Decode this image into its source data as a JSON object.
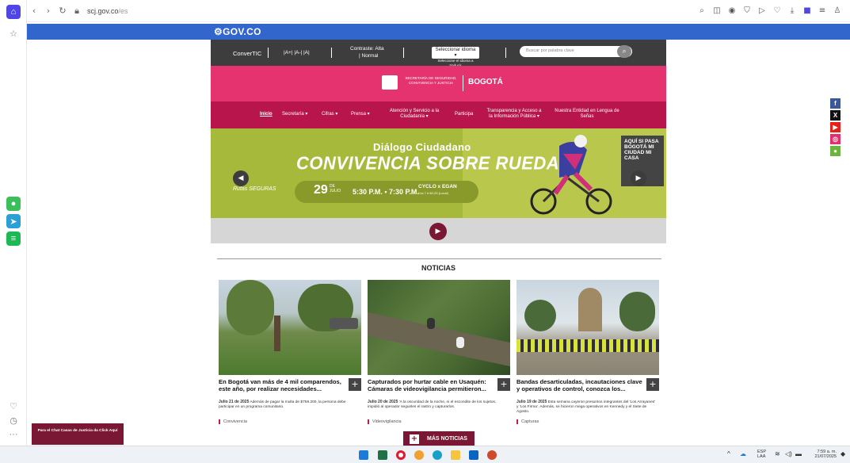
{
  "browser": {
    "url_host": "scj.gov.co",
    "url_path": "/es"
  },
  "gov": {
    "logo": "GOV.CO"
  },
  "topbar": {
    "convertic": "ConverTIC",
    "font_sizes": "|A+| |A-| |A|",
    "contrast_line1": "Contraste: Alta",
    "contrast_line2": "| Normal",
    "lang_select": "Seleccionar idioma",
    "lang_hint": "Seleccione el idioma a traducir",
    "search_placeholder": "Buscar por palabra clave"
  },
  "header": {
    "secretaria": "SECRETARÍA DE SEGURIDAD, CONVIVENCIA Y JUSTICIA",
    "bogota": "BOGOTÁ"
  },
  "nav": {
    "items": [
      {
        "label": "Inicio"
      },
      {
        "label": "Secretaría"
      },
      {
        "label": "Cifras"
      },
      {
        "label": "Prensa"
      },
      {
        "label": "Atención y Servicio a la Ciudadanía"
      },
      {
        "label": "Participa"
      },
      {
        "label": "Transparencia y Acceso a la Información Pública"
      },
      {
        "label": "Nuestra Entidad en Lengua de Señas"
      }
    ]
  },
  "banner": {
    "title": "Diálogo Ciudadano",
    "headline": "CONVIVENCIA SOBRE RUEDAS",
    "day": "29",
    "month_top": "DE",
    "month": "JULIO",
    "time": "5:30 P.M. • 7:30 P.M.",
    "place": "CYCLO x EGAN",
    "address": "Cra 7 # 80-29 (Local)",
    "rutas": "Rutas SEGURAS",
    "aqui": "AQUÍ SI PASA BOGOTÁ MI CIUDAD MI CASA"
  },
  "news": {
    "heading": "NOTICIAS",
    "more": "MÁS NOTICIAS",
    "items": [
      {
        "title": "En Bogotá van más de 4 mil comparendos, este año, por realizar necesidades...",
        "date": "Julio 21 de 2025",
        "snippet": "Además de pagar la multa de $759.200, la persona debe participar en un programa comunitario.",
        "category": "Convivencia"
      },
      {
        "title": "Capturados por hurtar cable en Usaquén: Cámaras de videovigilancia permitieron...",
        "date": "Julio 20 de 2025",
        "snippet": "'A la oscuridad de la noche, ni el escondite de los sujetos, impidió al operador seguirles el rastro y capturarlos.",
        "category": "Videovigilancia"
      },
      {
        "title": "Bandas desarticuladas, incautaciones clave y operativos de control, conozca los...",
        "date": "Julio 19 de 2025",
        "snippet": "Esta semana cayeron presuntos integrantes del 'Los Arrayanes' y 'Los Firma'. Además, se hicieron mega operativos en Kennedy y el Siete de Agosto.",
        "category": "Capturas"
      }
    ]
  },
  "chat": {
    "label": "Para el Chat Casas de Justicia da Click Aquí"
  },
  "taskbar": {
    "lang": "ESP",
    "lang2": "LAA",
    "time": "7:59 a. m.",
    "date": "21/07/2025"
  },
  "colors": {
    "gov_blue": "#3366cc",
    "pink": "#e4336f",
    "wine": "#b8154d",
    "banner_green": "#a7b93a"
  }
}
